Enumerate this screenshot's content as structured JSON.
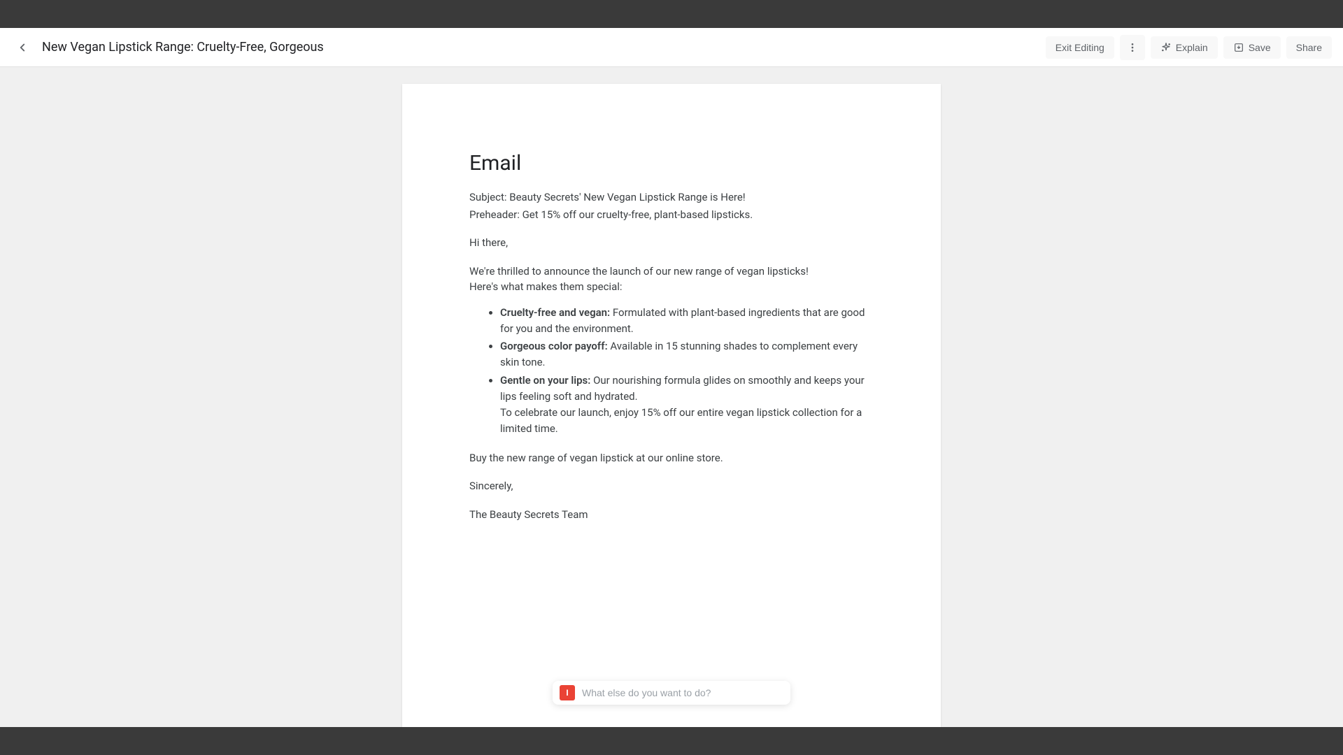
{
  "header": {
    "title": "New Vegan Lipstick Range: Cruelty-Free, Gorgeous"
  },
  "toolbar": {
    "exit_editing": "Exit Editing",
    "explain": "Explain",
    "save": "Save",
    "share": "Share"
  },
  "document": {
    "heading": "Email",
    "subject": "Subject: Beauty Secrets' New Vegan Lipstick Range is Here!",
    "preheader": "Preheader: Get 15% off our cruelty-free, plant-based lipsticks.",
    "greeting": "Hi there,",
    "intro1": "We're thrilled to announce the launch of our new range of vegan lipsticks!",
    "intro2": "Here's what makes them special:",
    "bullets": {
      "b1_label": "Cruelty-free and vegan:",
      "b1_text": " Formulated with plant-based ingredients that are good for you and the environment.",
      "b2_label": "Gorgeous color payoff:",
      "b2_text": " Available in 15 stunning shades to complement every skin tone.",
      "b3_label": "Gentle on your lips:",
      "b3_text": "  Our nourishing formula glides on smoothly and keeps your lips feeling soft and hydrated.",
      "b3_extra": "To celebrate our launch, enjoy 15% off our entire vegan lipstick collection for a limited time."
    },
    "cta": "Buy the new range of vegan lipstick at our online store.",
    "signoff": "Sincerely,",
    "signature": "The Beauty Secrets Team"
  },
  "prompt": {
    "placeholder": "What else do you want to do?",
    "icon_label": "I"
  }
}
